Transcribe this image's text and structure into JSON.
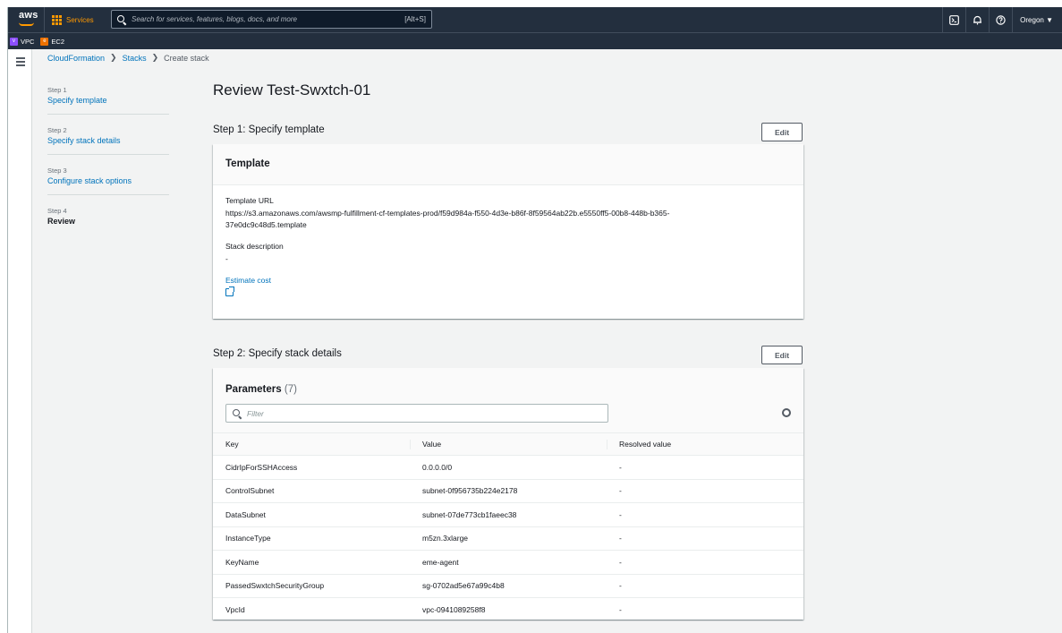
{
  "topnav": {
    "logo": "aws",
    "services_label": "Services",
    "search_placeholder": "Search for services, features, blogs, docs, and more",
    "search_shortcut": "[Alt+S]",
    "region": "Oregon ▼"
  },
  "favorites": [
    {
      "badge": "v",
      "label": "VPC",
      "color": "#8c4fff"
    },
    {
      "badge": "e",
      "label": "EC2",
      "color": "#ed7100"
    }
  ],
  "breadcrumb": {
    "items": [
      "CloudFormation",
      "Stacks"
    ],
    "current": "Create stack",
    "separator": "❯"
  },
  "steps": [
    {
      "num": "Step 1",
      "title": "Specify template",
      "current": false
    },
    {
      "num": "Step 2",
      "title": "Specify stack details",
      "current": false
    },
    {
      "num": "Step 3",
      "title": "Configure stack options",
      "current": false
    },
    {
      "num": "Step 4",
      "title": "Review",
      "current": true
    }
  ],
  "page_title": "Review Test-Swxtch-01",
  "section1": {
    "heading": "Step 1: Specify template",
    "edit_label": "Edit",
    "panel_title": "Template",
    "template_url_label": "Template URL",
    "template_url_line1": "https://s3.amazonaws.com/awsmp-fulfillment-cf-templates-prod/f59d984a-f550-4d3e-b86f-8f59564ab22b.e5550ff5-00b8-448b-b365-",
    "template_url_line2": "37e0dc9c48d5.template",
    "stack_desc_label": "Stack description",
    "stack_desc_value": "-",
    "estimate_cost": "Estimate cost"
  },
  "section2": {
    "heading": "Step 2: Specify stack details",
    "edit_label": "Edit",
    "panel_title": "Parameters",
    "count": "(7)",
    "filter_placeholder": "Filter",
    "columns": [
      "Key",
      "Value",
      "Resolved value"
    ],
    "rows": [
      [
        "CidrIpForSSHAccess",
        "0.0.0.0/0",
        "-"
      ],
      [
        "ControlSubnet",
        "subnet-0f956735b224e2178",
        "-"
      ],
      [
        "DataSubnet",
        "subnet-07de773cb1faeec38",
        "-"
      ],
      [
        "InstanceType",
        "m5zn.3xlarge",
        "-"
      ],
      [
        "KeyName",
        "eme-agent",
        "-"
      ],
      [
        "PassedSwxtchSecurityGroup",
        "sg-0702ad5e67a99c4b8",
        "-"
      ],
      [
        "VpcId",
        "vpc-0941089258f8",
        "-"
      ]
    ]
  }
}
